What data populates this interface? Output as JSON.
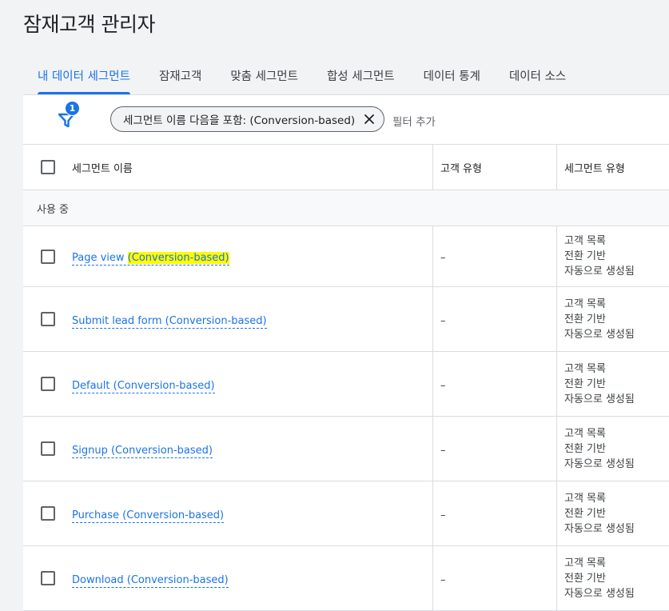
{
  "page": {
    "title": "잠재고객 관리자"
  },
  "tabs": [
    {
      "label": "내 데이터 세그먼트",
      "active": true
    },
    {
      "label": "잠재고객"
    },
    {
      "label": "맞춤 세그먼트"
    },
    {
      "label": "합성 세그먼트"
    },
    {
      "label": "데이터 통계"
    },
    {
      "label": "데이터 소스"
    }
  ],
  "filter": {
    "count": "1",
    "chip_label": "세그먼트 이름 다음을 포함: (Conversion-based)",
    "add_filter": "필터 추가"
  },
  "table": {
    "headers": {
      "name": "세그먼트 이름",
      "customer_type": "고객 유형",
      "segment_type": "세그먼트 유형"
    },
    "group_label": "사용 중",
    "rows": [
      {
        "name_prefix": "Page view ",
        "name_highlight": "(Conversion-based)",
        "customer_type": "–",
        "segment_type": [
          "고객 목록",
          "전환 기반",
          "자동으로 생성됨"
        ]
      },
      {
        "name_prefix": "Submit lead form ",
        "name_highlight": "(Conversion-based)",
        "customer_type": "–",
        "segment_type": [
          "고객 목록",
          "전환 기반",
          "자동으로 생성됨"
        ]
      },
      {
        "name_prefix": "Default ",
        "name_highlight": "(Conversion-based)",
        "customer_type": "–",
        "segment_type": [
          "고객 목록",
          "전환 기반",
          "자동으로 생성됨"
        ]
      },
      {
        "name_prefix": "Signup ",
        "name_highlight": "(Conversion-based)",
        "customer_type": "–",
        "segment_type": [
          "고객 목록",
          "전환 기반",
          "자동으로 생성됨"
        ]
      },
      {
        "name_prefix": "Purchase ",
        "name_highlight": "(Conversion-based)",
        "customer_type": "–",
        "segment_type": [
          "고객 목록",
          "전환 기반",
          "자동으로 생성됨"
        ]
      },
      {
        "name_prefix": "Download ",
        "name_highlight": "(Conversion-based)",
        "customer_type": "–",
        "segment_type": [
          "고객 목록",
          "전환 기반",
          "자동으로 생성됨"
        ]
      }
    ]
  },
  "colors": {
    "accent": "#1a73e8",
    "highlight": "#fffb00",
    "background": "#f1f3f4"
  },
  "icons": {
    "filter": "filter-funnel-icon",
    "close": "close-icon"
  }
}
